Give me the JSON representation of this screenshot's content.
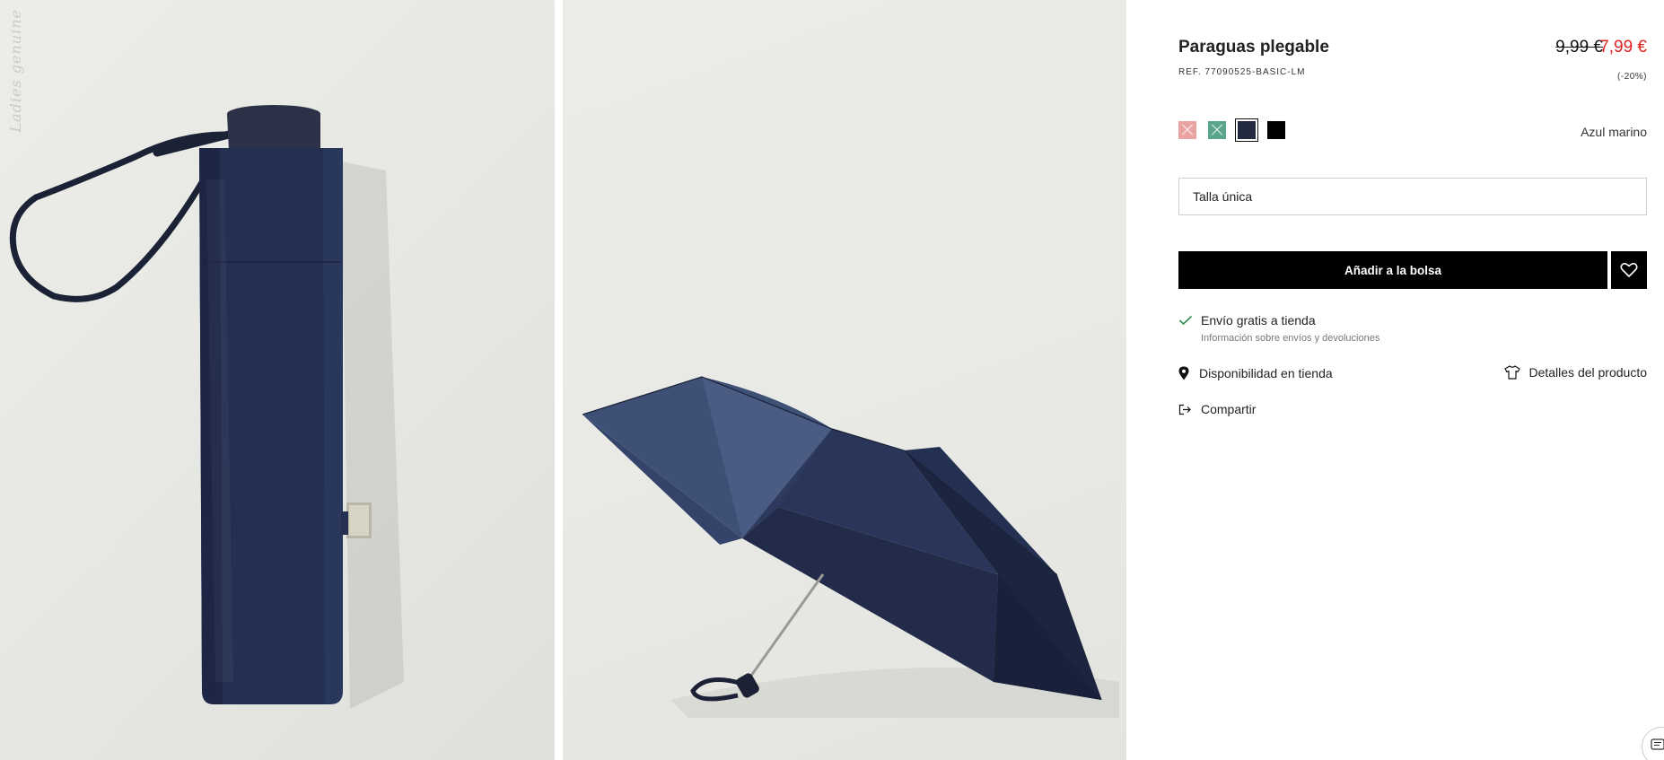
{
  "product": {
    "title": "Paraguas plegable",
    "ref": "REF. 77090525-BASIC-LM",
    "price_original": "9,99 €",
    "price_sale": "7,99 €",
    "discount": "(-20%)",
    "selected_color": "Azul marino"
  },
  "gallery": {
    "watermark": "Ladies genuine"
  },
  "colors": [
    {
      "icon": "swatch-pink",
      "hex": "#e9a3a0",
      "available": false
    },
    {
      "icon": "swatch-green",
      "hex": "#5aa68d",
      "available": false
    },
    {
      "icon": "swatch-navy",
      "hex": "#222b41",
      "available": true,
      "selected": true
    },
    {
      "icon": "swatch-black",
      "hex": "#000000",
      "available": true
    }
  ],
  "size": {
    "value": "Talla única"
  },
  "actions": {
    "add_to_bag": "Añadir a la bolsa",
    "favorite_icon": "heart-icon"
  },
  "shipping": {
    "label": "Envío gratis a tienda",
    "info": "Información sobre envíos y devoluciones"
  },
  "links": {
    "availability": "Disponibilidad en tienda",
    "details": "Detalles del producto",
    "share": "Compartir"
  },
  "theme": {
    "sale_color": "#e0201e",
    "button_color": "#000000",
    "umbrella_navy": "#222b45"
  }
}
